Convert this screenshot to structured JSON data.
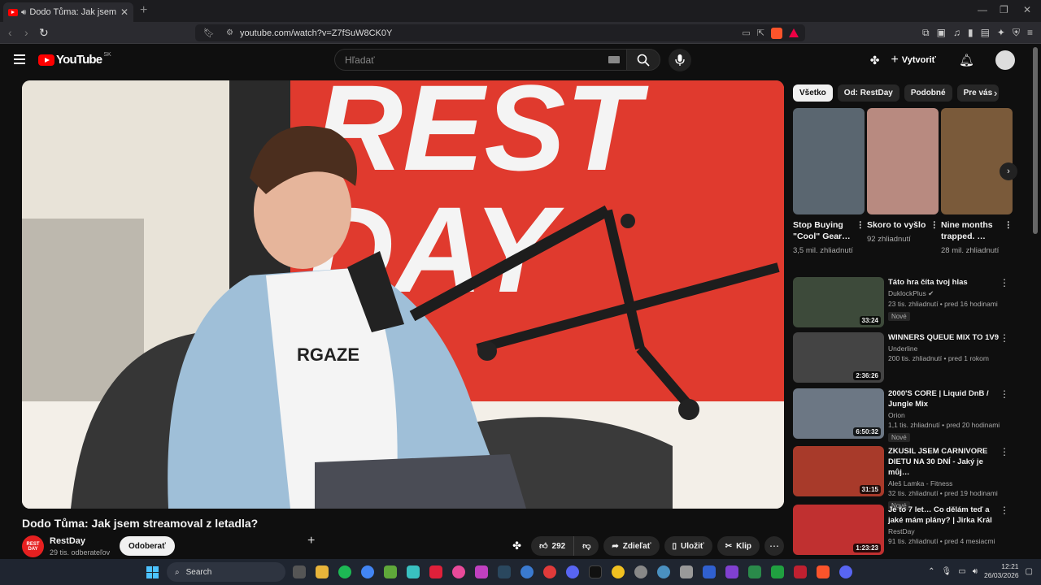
{
  "browser": {
    "tab_title": "Dodo Tůma: Jak jsem streamoval z letadla?",
    "url": "youtube.com/watch?v=Z7fSuW8CK0Y"
  },
  "masthead": {
    "logo_text": "YouTube",
    "country_code": "SK",
    "search_placeholder": "Hľadať",
    "create_label": "Vytvoriť"
  },
  "video": {
    "title": "Dodo Tůma: Jak jsem streamoval z letadla?",
    "channel": "RestDay",
    "channel_avatar_text": "REST DAY",
    "subscribers": "29 tis. odberateľov",
    "subscribe_label": "Odoberať",
    "likes": "292",
    "share_label": "Zdieľať",
    "save_label": "Uložiť",
    "clip_label": "Klip"
  },
  "chips": [
    "Všetko",
    "Od: RestDay",
    "Podobné",
    "Pre vás"
  ],
  "shorts": [
    {
      "title": "Stop Buying \"Cool\" Gear…",
      "views": "3,5 mil. zhliadnutí",
      "thumb_color": "#5a6670"
    },
    {
      "title": "Skoro to vyšlo",
      "views": "92 zhliadnutí",
      "thumb_color": "#b88a80"
    },
    {
      "title": "Nine months trapped. …",
      "views": "28 mil. zhliadnutí",
      "thumb_color": "#7a5a3a"
    }
  ],
  "recommendations": [
    {
      "title": "Táto hra číta tvoj hlas",
      "channel": "DuklockPlus ✔",
      "meta": "23 tis. zhliadnutí • pred 16 hodinami",
      "badge": "Nové",
      "duration": "33:24",
      "thumb_color": "#3d4a3a"
    },
    {
      "title": "WINNERS QUEUE MIX TO 1V9",
      "channel": "Underline",
      "meta": "200 tis. zhliadnutí • pred 1 rokom",
      "badge": "",
      "duration": "2:36:26",
      "thumb_color": "#444"
    },
    {
      "title": "2000'S CORE | Liquid DnB / Jungle Mix",
      "channel": "Orion",
      "meta": "1,1 tis. zhliadnutí • pred 20 hodinami",
      "badge": "Nové",
      "duration": "6:50:32",
      "thumb_color": "#6c7784"
    },
    {
      "title": "ZKUSIL JSEM CARNIVORE DIETU NA 30 DNÍ - Jaký je můj…",
      "channel": "Aleš Lamka - Fitness",
      "meta": "32 tis. zhliadnutí • pred 19 hodinami",
      "badge": "Nové",
      "duration": "31:15",
      "thumb_color": "#a83a2a"
    },
    {
      "title": "Je to 7 let… Co dělám teď a jaké mám plány? | Jirka Král",
      "channel": "RestDay",
      "meta": "91 tis. zhliadnutí • pred 4 mesiacmi",
      "badge": "",
      "duration": "1:23:23",
      "thumb_color": "#c03030"
    }
  ],
  "taskbar": {
    "search_label": "Search",
    "time": "12:21",
    "date": "26/03/2026"
  }
}
